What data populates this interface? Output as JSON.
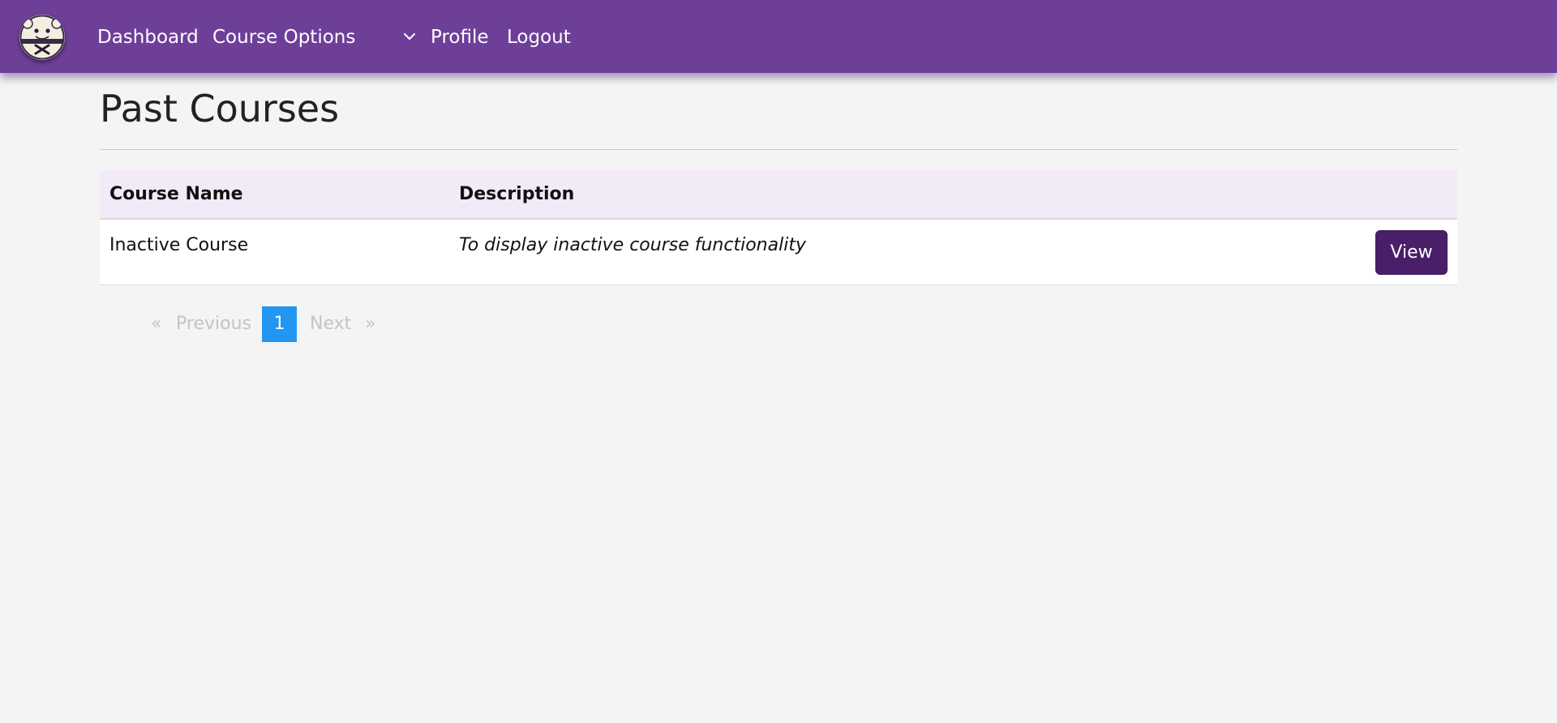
{
  "navbar": {
    "items": {
      "dashboard": "Dashboard",
      "course_options": "Course Options",
      "profile": "Profile",
      "logout": "Logout"
    },
    "dropdown_icon": "chevron-down-icon",
    "logo_icon": "mascot-logo-icon",
    "color": "#6e3f98"
  },
  "main": {
    "title": "Past Courses",
    "table": {
      "headers": {
        "name": "Course Name",
        "description": "Description"
      },
      "rows": [
        {
          "name": "Inactive Course",
          "description": "To display inactive course functionality",
          "action_label": "View"
        }
      ],
      "header_bg": "#f3eaf7",
      "action_color": "#4a1f6a"
    }
  },
  "pagination": {
    "first": "«",
    "prev": "Previous",
    "current": "1",
    "next": "Next",
    "last": "»",
    "active_color": "#2196f3"
  }
}
